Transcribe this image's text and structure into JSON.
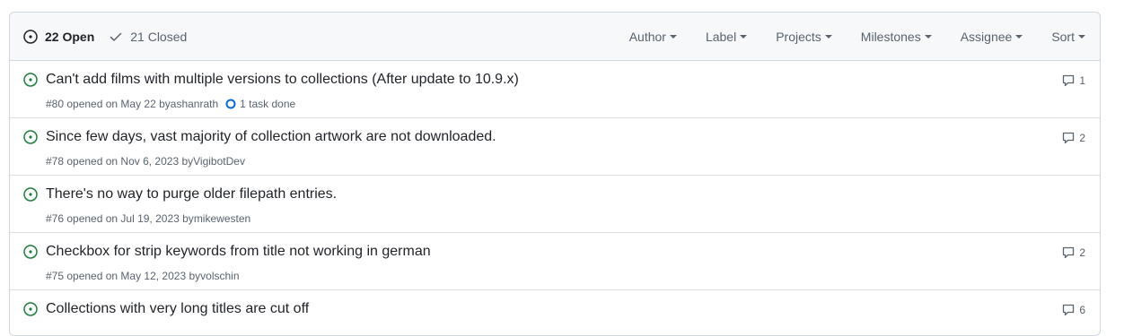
{
  "header": {
    "open_label": "22 Open",
    "closed_label": "21 Closed",
    "filters": [
      {
        "label": "Author",
        "icon": "caret-down-icon"
      },
      {
        "label": "Label",
        "icon": "caret-down-icon"
      },
      {
        "label": "Projects",
        "icon": "caret-down-icon"
      },
      {
        "label": "Milestones",
        "icon": "caret-down-icon"
      },
      {
        "label": "Assignee",
        "icon": "caret-down-icon"
      },
      {
        "label": "Sort",
        "icon": "caret-down-icon"
      }
    ]
  },
  "issues": [
    {
      "title": "Can't add films with multiple versions to collections (After update to 10.9.x)",
      "meta": "#80 opened on May 22 by ",
      "author": "ashanrath",
      "task": "1 task done",
      "comments": "1"
    },
    {
      "title": "Since few days, vast majority of collection artwork are not downloaded.",
      "meta": "#78 opened on Nov 6, 2023 by ",
      "author": "VigibotDev",
      "comments": "2"
    },
    {
      "title": "There's no way to purge older filepath entries.",
      "meta": "#76 opened on Jul 19, 2023 by ",
      "author": "mikewesten"
    },
    {
      "title": "Checkbox for strip keywords from title not working in german",
      "meta": "#75 opened on May 12, 2023 by ",
      "author": "volschin",
      "comments": "2"
    },
    {
      "title": "Collections with very long titles are cut off",
      "meta": "",
      "author": "",
      "comments": "6"
    }
  ],
  "colors": {
    "open_green": "#1a7f37",
    "muted": "#59636e",
    "task_blue": "#0969da",
    "border": "#d0d7de"
  }
}
